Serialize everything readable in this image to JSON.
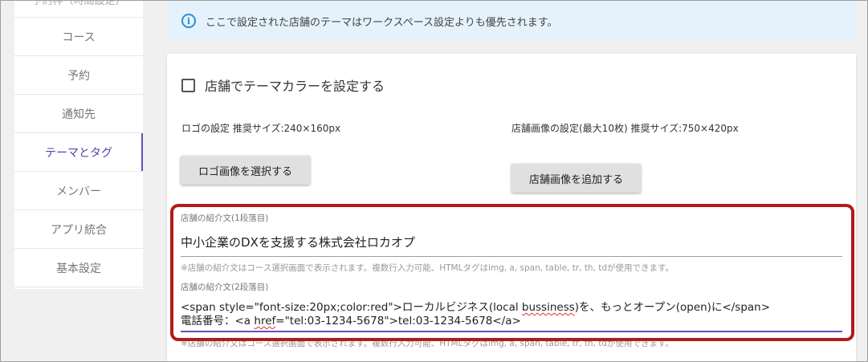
{
  "sidebar": {
    "items": [
      {
        "label": "予約枠（時間設定）"
      },
      {
        "label": "コース"
      },
      {
        "label": "予約"
      },
      {
        "label": "通知先"
      },
      {
        "label": "テーマとタグ"
      },
      {
        "label": "メンバー"
      },
      {
        "label": "アプリ統合"
      },
      {
        "label": "基本設定"
      }
    ]
  },
  "alert": {
    "text": "ここで設定された店舗のテーマはワークスペース設定よりも優先されます。"
  },
  "theme": {
    "checkbox_label": "店舗でテーマカラーを設定する",
    "checked": false
  },
  "logo": {
    "label": "ロゴの設定 推奨サイズ:240×160px",
    "button": "ロゴ画像を選択する"
  },
  "store_image": {
    "label": "店舗画像の設定(最大10枚) 推奨サイズ:750×420px",
    "button": "店舗画像を追加する"
  },
  "intro1": {
    "label": "店舗の紹介文(1段落目)",
    "value": "中小企業のDXを支援する株式会社ロカオプ",
    "hint": "※店舗の紹介文はコース選択画面で表示されます。複数行入力可能、HTMLタグはimg, a, span, table, tr, th, tdが使用できます。"
  },
  "intro2": {
    "label": "店舗の紹介文(2段落目)",
    "line1_a": "<span style=\"font-size:20px;color:red\">ローカルビジネス(local ",
    "line1_b": "bussiness",
    "line1_c": ")を、もっとオープン(open)に</span>",
    "line2_a": "電話番号：<a ",
    "line2_b": "href",
    "line2_c": "=\"tel:03-1234-5678\">tel:03-1234-5678</a>",
    "hint": "※店舗の紹介文はコース選択画面で表示されます。複数行入力可能、HTMLタグはimg, a, span, table, tr, th, tdが使用できます。"
  },
  "colors": {
    "accent": "#6a4cbf",
    "info": "#2b8ed6",
    "highlight": "#b31b1b"
  }
}
